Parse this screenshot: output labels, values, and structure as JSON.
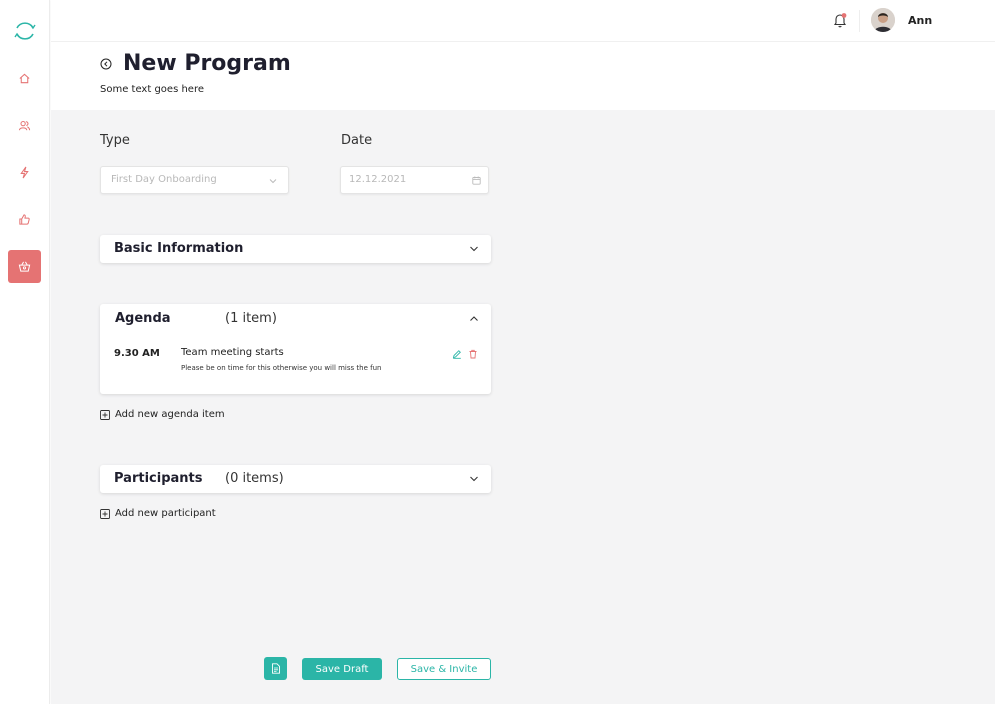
{
  "user": {
    "name": "Ann"
  },
  "colors": {
    "accent": "#2bb5a7",
    "danger": "#e57373",
    "background": "#f4f4f5"
  },
  "sidebar": {
    "items": [
      {
        "icon": "home-icon",
        "active": false
      },
      {
        "icon": "users-icon",
        "active": false
      },
      {
        "icon": "lightning-icon",
        "active": false
      },
      {
        "icon": "thumbs-up-icon",
        "active": false
      },
      {
        "icon": "gift-basket-icon",
        "active": true
      }
    ]
  },
  "header": {
    "title": "New Program",
    "subtitle": "Some text goes here"
  },
  "form": {
    "type_label": "Type",
    "type_value": "First Day Onboarding",
    "date_label": "Date",
    "date_value": "12.12.2021"
  },
  "sections": {
    "basic": {
      "title": "Basic Information"
    },
    "agenda": {
      "title": "Agenda",
      "count": "(1 item)",
      "items": [
        {
          "time": "9.30 AM",
          "title": "Team meeting starts",
          "description": "Please be on time for this otherwise you will miss the fun"
        }
      ],
      "add_label": "Add new agenda item"
    },
    "participants": {
      "title": "Participants",
      "count": "(0 items)",
      "add_label": "Add new participant"
    }
  },
  "actions": {
    "save_draft": "Save Draft",
    "save_invite": "Save & Invite"
  }
}
